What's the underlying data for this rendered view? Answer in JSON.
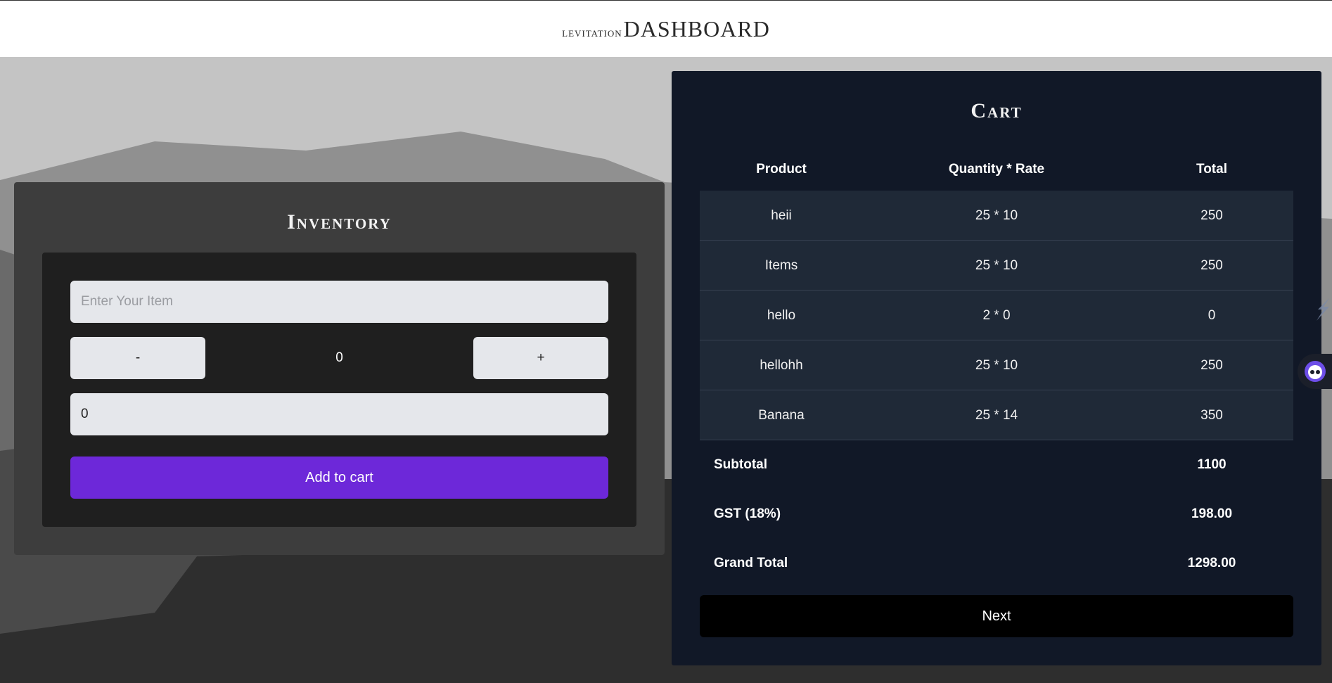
{
  "header": {
    "brand_small": "LEVITATION",
    "brand_big": "DASHBOARD"
  },
  "inventory": {
    "title": "Inventory",
    "item_placeholder": "Enter Your Item",
    "item_value": "",
    "minus_label": "-",
    "quantity": "0",
    "plus_label": "+",
    "price_value": "0",
    "add_label": "Add to cart"
  },
  "cart": {
    "title": "Cart",
    "columns": [
      "Product",
      "Quantity * Rate",
      "Total"
    ],
    "rows": [
      {
        "product": "heii",
        "qty_rate": "25 * 10",
        "total": "250"
      },
      {
        "product": "Items",
        "qty_rate": "25 * 10",
        "total": "250"
      },
      {
        "product": "hello",
        "qty_rate": "2 * 0",
        "total": "0"
      },
      {
        "product": "hellohh",
        "qty_rate": "25 * 10",
        "total": "250"
      },
      {
        "product": "Banana",
        "qty_rate": "25 * 14",
        "total": "350"
      }
    ],
    "subtotal_label": "Subtotal",
    "subtotal_value": "1100",
    "gst_label": "GST (18%)",
    "gst_value": "198.00",
    "grand_label": "Grand Total",
    "grand_value": "1298.00",
    "next_label": "Next"
  },
  "colors": {
    "accent": "#6d28d9",
    "cart_bg": "#111827",
    "row_bg": "#1f2937",
    "inventory_bg": "#3d3d3d"
  },
  "icons": [
    "extension-icon",
    "assistant-bot-icon"
  ]
}
